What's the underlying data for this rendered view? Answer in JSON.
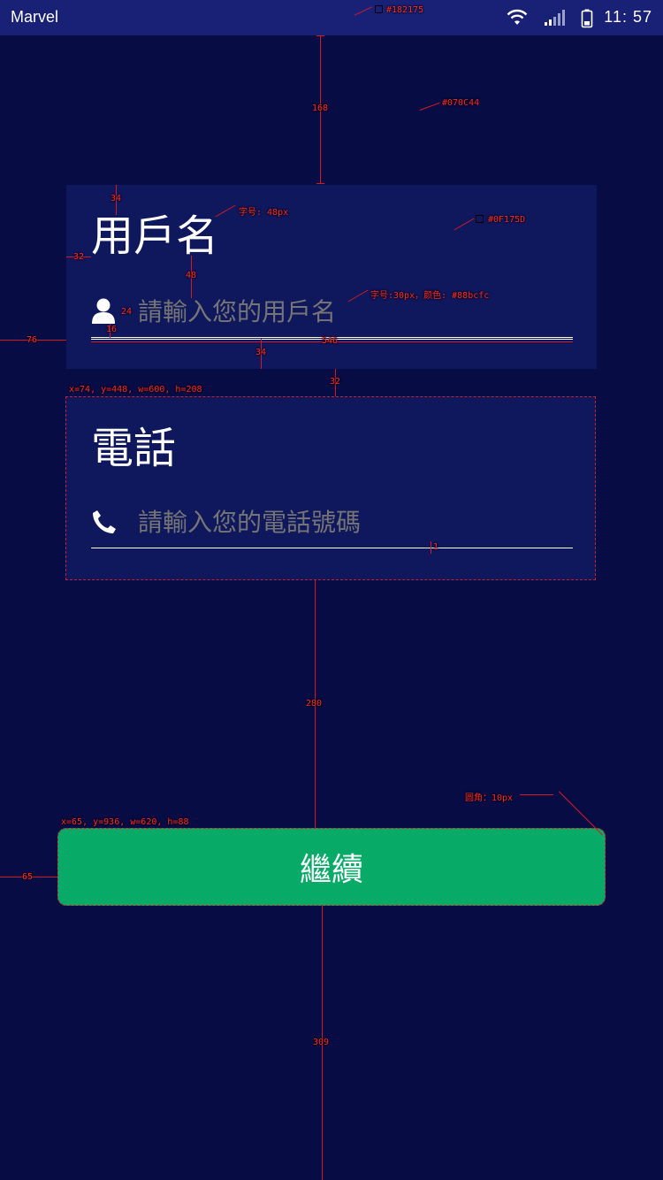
{
  "status_bar": {
    "carrier": "Marvel",
    "time": "11: 57",
    "background": "#182175"
  },
  "colors": {
    "page_bg": "#070C44",
    "card_bg": "#0F175D",
    "placeholder": "#88bcfc",
    "button_bg": "#07AB67"
  },
  "username_card": {
    "title": "用戶名",
    "placeholder": "請輸入您的用戶名",
    "icon": "user-icon"
  },
  "phone_card": {
    "title": "電話",
    "placeholder": "請輸入您的電話號碼",
    "icon": "phone-icon"
  },
  "continue_button": {
    "label": "繼續"
  },
  "annotations": {
    "status_color": "#182175",
    "bg_color": "#070C44",
    "card_color": "#0F175D",
    "title_font": "字号: 48px",
    "placeholder_font": "字号:30px，颜色: #88bcfc",
    "gap_top": "168",
    "title_pad_top": "34",
    "left_pad": "32",
    "title_gap": "48",
    "icon_gap": "24",
    "icon_pad": "16",
    "page_left": "76",
    "line_width": "546",
    "bottom_pad": "34",
    "card_gap": "32",
    "phone_box": "x=74, y=448, w=600, h=208",
    "line_thick": "1",
    "gap_mid": "280",
    "radius": "圆角：10px",
    "button_box": "x=65, y=936, w=620, h=88",
    "button_left": "65",
    "gap_bottom": "309"
  }
}
